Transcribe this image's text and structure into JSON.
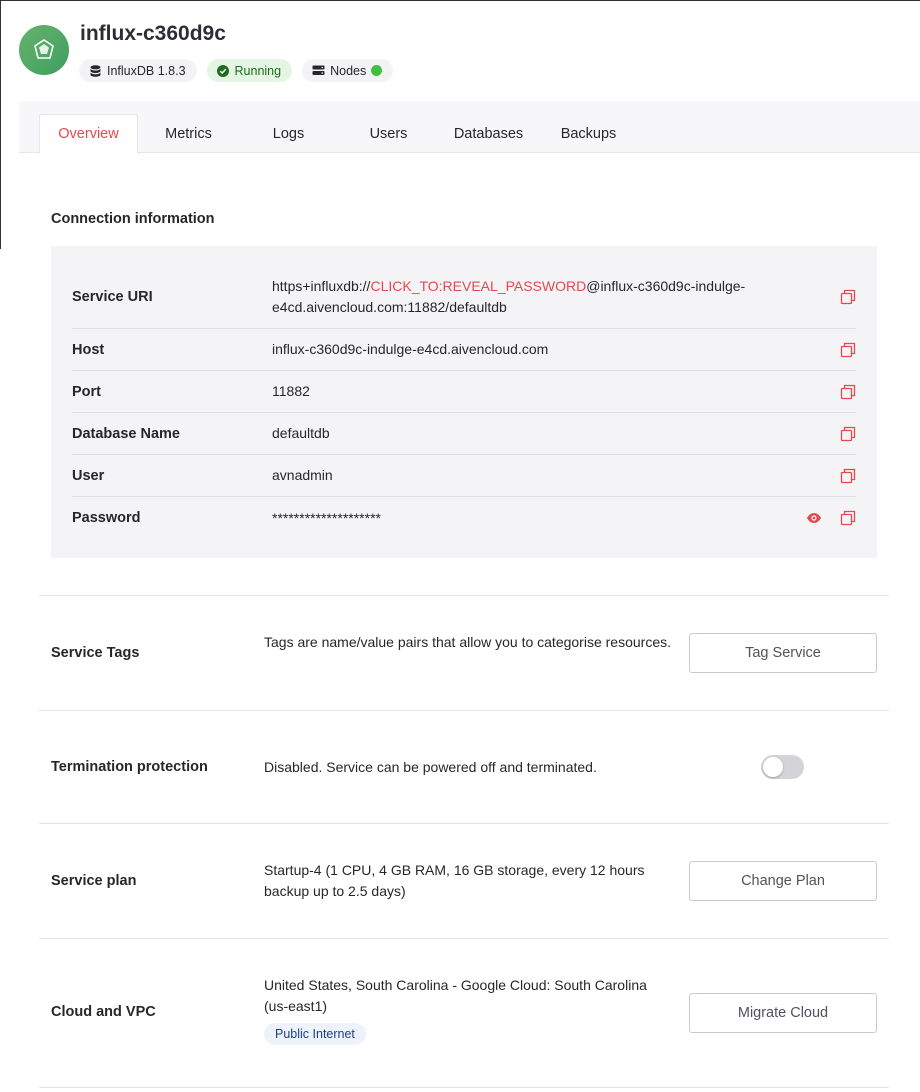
{
  "header": {
    "title": "influx-c360d9c",
    "badges": {
      "version": "InfluxDB 1.8.3",
      "status": "Running",
      "nodes": "Nodes"
    }
  },
  "tabs": [
    "Overview",
    "Metrics",
    "Logs",
    "Users",
    "Databases",
    "Backups"
  ],
  "connection": {
    "title": "Connection information",
    "rows": [
      {
        "label": "Service URI",
        "value_prefix": "https+influxdb://",
        "value_highlight": "CLICK_TO:REVEAL_PASSWORD",
        "value_suffix": "@influx-c360d9c-indulge-e4cd.aivencloud.com:11882/defaultdb"
      },
      {
        "label": "Host",
        "value": "influx-c360d9c-indulge-e4cd.aivencloud.com"
      },
      {
        "label": "Port",
        "value": "11882"
      },
      {
        "label": "Database Name",
        "value": "defaultdb"
      },
      {
        "label": "User",
        "value": "avnadmin"
      },
      {
        "label": "Password",
        "value": "********************"
      }
    ]
  },
  "settings": {
    "tags": {
      "label": "Service Tags",
      "desc": "Tags are name/value pairs that allow you to categorise resources.",
      "button": "Tag Service"
    },
    "termination": {
      "label": "Termination protection",
      "desc": "Disabled. Service can be powered off and terminated.",
      "enabled": false
    },
    "plan": {
      "label": "Service plan",
      "desc": "Startup-4 (1 CPU, 4 GB RAM, 16 GB storage, every 12 hours backup up to 2.5 days)",
      "button": "Change Plan"
    },
    "cloud": {
      "label": "Cloud and VPC",
      "desc": "United States, South Carolina - Google Cloud: South Carolina (us-east1)",
      "tag": "Public Internet",
      "button": "Migrate Cloud"
    }
  },
  "colors": {
    "accent": "#e5484d",
    "running": "#3fc23b",
    "logo": "#4caf65"
  }
}
